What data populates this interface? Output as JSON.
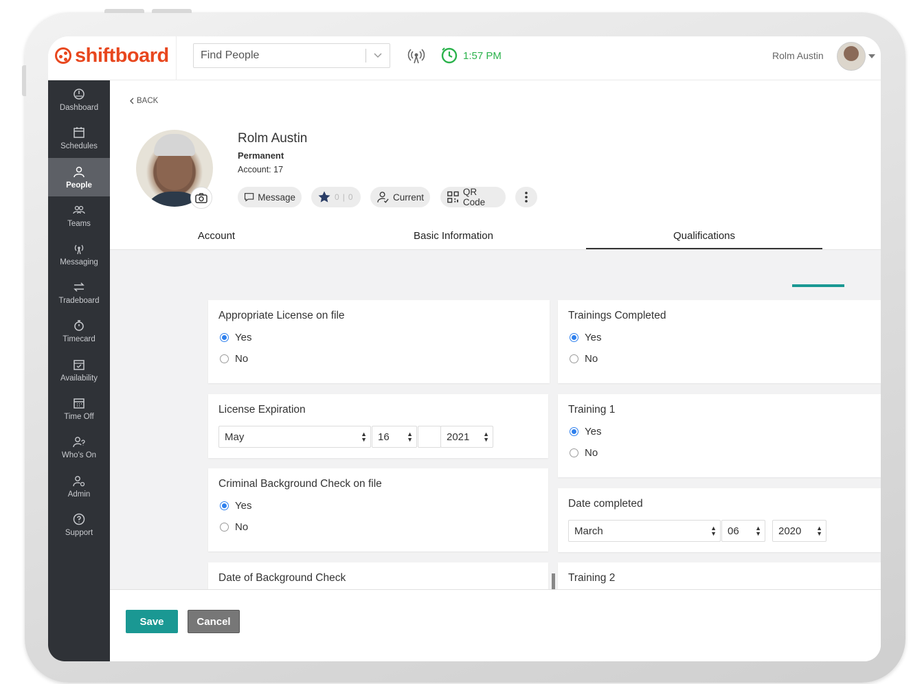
{
  "app": {
    "logo_text": "shiftboard",
    "brand_color": "#e8471e",
    "accent_color": "#1a9893"
  },
  "header": {
    "search_placeholder": "Find People",
    "time": "1:57 PM",
    "user_name": "Rolm Austin"
  },
  "sidebar": {
    "items": [
      {
        "label": "Dashboard",
        "icon": "dashboard-icon"
      },
      {
        "label": "Schedules",
        "icon": "calendar-icon"
      },
      {
        "label": "People",
        "icon": "person-icon",
        "active": true
      },
      {
        "label": "Teams",
        "icon": "teams-icon"
      },
      {
        "label": "Messaging",
        "icon": "broadcast-icon"
      },
      {
        "label": "Tradeboard",
        "icon": "swap-arrows-icon"
      },
      {
        "label": "Timecard",
        "icon": "stopwatch-icon"
      },
      {
        "label": "Availability",
        "icon": "calendar-check-icon"
      },
      {
        "label": "Time Off",
        "icon": "calendar-grid-icon"
      },
      {
        "label": "Who's On",
        "icon": "person-question-icon"
      },
      {
        "label": "Admin",
        "icon": "person-gear-icon"
      },
      {
        "label": "Support",
        "icon": "help-icon"
      }
    ]
  },
  "profile": {
    "back_label": "BACK",
    "name": "Rolm Austin",
    "type": "Permanent",
    "account": "Account: 17",
    "actions": {
      "message": "Message",
      "star_count_a": "0",
      "star_count_b": "0",
      "current": "Current",
      "qr_code": "QR Code"
    }
  },
  "tabs": [
    "Account",
    "Basic Information",
    "Qualifications"
  ],
  "active_tab": "Qualifications",
  "form": {
    "left": {
      "license_on_file": {
        "title": "Appropriate License on file",
        "yes": "Yes",
        "no": "No",
        "selected": "Yes"
      },
      "license_expiration": {
        "title": "License Expiration",
        "month": "May",
        "day": "16",
        "year": "2021"
      },
      "background_check": {
        "title": "Criminal Background Check on file",
        "yes": "Yes",
        "no": "No",
        "selected": "Yes"
      },
      "background_date": {
        "title": "Date of Background Check"
      }
    },
    "right": {
      "trainings_completed": {
        "title": "Trainings Completed",
        "yes": "Yes",
        "no": "No",
        "selected": "Yes"
      },
      "training_1": {
        "title": "Training 1",
        "yes": "Yes",
        "no": "No",
        "selected": "Yes"
      },
      "date_completed": {
        "title": "Date completed",
        "month": "March",
        "day": "06",
        "year": "2020"
      },
      "training_2": {
        "title": "Training 2"
      }
    }
  },
  "footer": {
    "save": "Save",
    "cancel": "Cancel"
  }
}
